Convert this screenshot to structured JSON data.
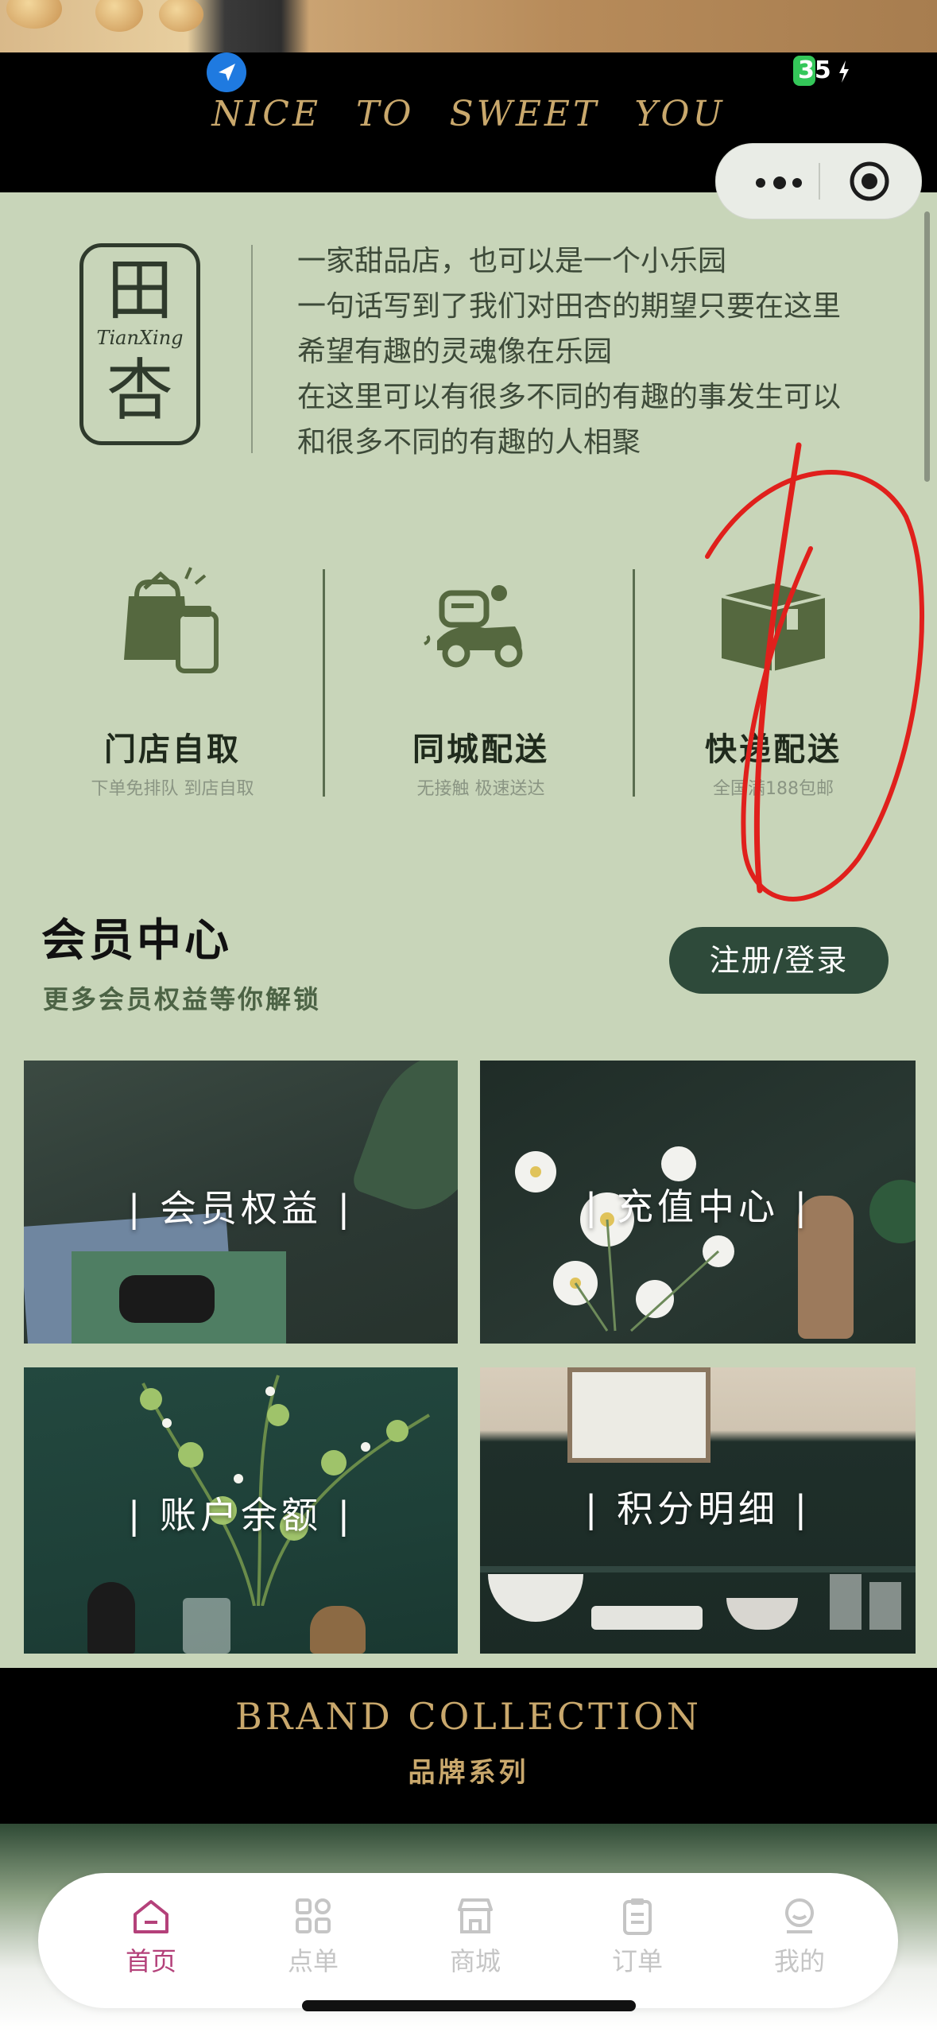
{
  "status_bar": {
    "battery": "35"
  },
  "banner": {
    "title": "NICE TO SWEET YOU"
  },
  "brand_logo": {
    "char_top": "田",
    "pinyin": "TianXing",
    "char_bottom": "杏"
  },
  "intro": {
    "lines": [
      "一家甜品店，也可以是一个小乐园",
      "一句话写到了我们对田杏的期望只要在这里",
      "希望有趣的灵魂像在乐园",
      "在这里可以有很多不同的有趣的事发生可以",
      "和很多不同的有趣的人相聚"
    ]
  },
  "services": [
    {
      "title": "门店自取",
      "subtitle": "下单免排队 到店自取",
      "icon": "store-pickup-icon"
    },
    {
      "title": "同城配送",
      "subtitle": "无接触 极速送达",
      "icon": "delivery-scooter-icon"
    },
    {
      "title": "快递配送",
      "subtitle": "全国满188包邮",
      "icon": "package-box-icon"
    }
  ],
  "member": {
    "title": "会员中心",
    "subtitle": "更多会员权益等你解锁",
    "login_label": "注册/登录",
    "tiles": [
      {
        "label": "| 会员权益 |"
      },
      {
        "label": "| 充值中心 |"
      },
      {
        "label": "| 账户余额 |"
      },
      {
        "label": "| 积分明细 |"
      }
    ]
  },
  "brand": {
    "title": "BRAND COLLECTION",
    "subtitle": "品牌系列"
  },
  "tabs": [
    {
      "label": "首页",
      "icon": "home-icon",
      "active": true
    },
    {
      "label": "点单",
      "icon": "grid-icon",
      "active": false
    },
    {
      "label": "商城",
      "icon": "shop-icon",
      "active": false
    },
    {
      "label": "订单",
      "icon": "clipboard-icon",
      "active": false
    },
    {
      "label": "我的",
      "icon": "user-icon",
      "active": false
    }
  ],
  "colors": {
    "page_bg": "#c8d5b9",
    "accent_gold": "#c9a86c",
    "dark_green": "#2e4a3a",
    "active_tab": "#b4417a",
    "annotation_red": "#e0201c"
  }
}
